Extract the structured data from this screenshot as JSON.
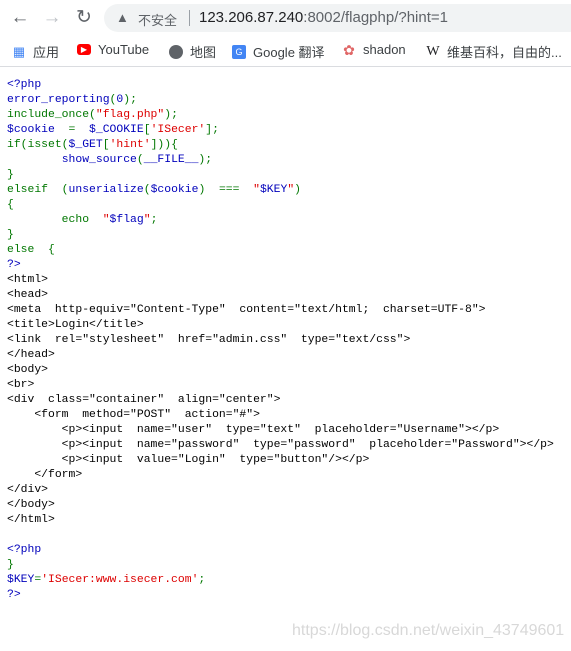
{
  "browser": {
    "security_label": "不安全",
    "url_host": "123.206.87.240",
    "url_rest": ":8002/flagphp/?hint=1"
  },
  "bookmarks": [
    {
      "label": "应用",
      "icon": "apps-grid-icon"
    },
    {
      "label": "YouTube",
      "icon": "youtube-icon"
    },
    {
      "label": "地图",
      "icon": "globe-icon"
    },
    {
      "label": "Google 翻译",
      "icon": "google-translate-icon"
    },
    {
      "label": "shadon",
      "icon": "shadon-icon"
    },
    {
      "label": "维基百科，自由的...",
      "icon": "wikipedia-icon"
    }
  ],
  "colors": {
    "default": "#0000BB",
    "keyword": "#007700",
    "string": "#DD0000",
    "html": "#000000"
  },
  "code": [
    [
      [
        "d",
        "<?php"
      ]
    ],
    [
      [
        "d",
        "error_reporting"
      ],
      [
        "k",
        "("
      ],
      [
        "d",
        "0"
      ],
      [
        "k",
        ");"
      ]
    ],
    [
      [
        "k",
        "include_once("
      ],
      [
        "s",
        "\"flag.php\""
      ],
      [
        "k",
        ");"
      ]
    ],
    [
      [
        "d",
        "$cookie  "
      ],
      [
        "k",
        "=  "
      ],
      [
        "d",
        "$_COOKIE"
      ],
      [
        "k",
        "["
      ],
      [
        "s",
        "'ISecer'"
      ],
      [
        "k",
        "];"
      ]
    ],
    [
      [
        "k",
        "if(isset("
      ],
      [
        "d",
        "$_GET"
      ],
      [
        "k",
        "["
      ],
      [
        "s",
        "'hint'"
      ],
      [
        "k",
        "])){"
      ]
    ],
    [
      [
        "k",
        "        "
      ],
      [
        "d",
        "show_source"
      ],
      [
        "k",
        "("
      ],
      [
        "d",
        "__FILE__"
      ],
      [
        "k",
        ");"
      ]
    ],
    [
      [
        "k",
        "}"
      ]
    ],
    [
      [
        "k",
        "elseif  ("
      ],
      [
        "d",
        "unserialize"
      ],
      [
        "k",
        "("
      ],
      [
        "d",
        "$cookie"
      ],
      [
        "k",
        ")  ===  "
      ],
      [
        "s",
        "\""
      ],
      [
        "d",
        "$KEY"
      ],
      [
        "s",
        "\""
      ],
      [
        "k",
        ")"
      ]
    ],
    [
      [
        "k",
        "{"
      ]
    ],
    [
      [
        "k",
        "        echo  "
      ],
      [
        "s",
        "\""
      ],
      [
        "d",
        "$flag"
      ],
      [
        "s",
        "\""
      ],
      [
        "k",
        ";"
      ]
    ],
    [
      [
        "k",
        "}"
      ]
    ],
    [
      [
        "k",
        "else  {"
      ]
    ],
    [
      [
        "d",
        "?>"
      ]
    ],
    [
      [
        "h",
        "<html>"
      ]
    ],
    [
      [
        "h",
        "<head>"
      ]
    ],
    [
      [
        "h",
        "<meta  http-equiv=\"Content-Type\"  content=\"text/html;  charset=UTF-8\">"
      ]
    ],
    [
      [
        "h",
        "<title>Login</title>"
      ]
    ],
    [
      [
        "h",
        "<link  rel=\"stylesheet\"  href=\"admin.css\"  type=\"text/css\">"
      ]
    ],
    [
      [
        "h",
        "</head>"
      ]
    ],
    [
      [
        "h",
        "<body>"
      ]
    ],
    [
      [
        "h",
        "<br>"
      ]
    ],
    [
      [
        "h",
        "<div  class=\"container\"  align=\"center\">"
      ]
    ],
    [
      [
        "h",
        "    <form  method=\"POST\"  action=\"#\">"
      ]
    ],
    [
      [
        "h",
        "        <p><input  name=\"user\"  type=\"text\"  placeholder=\"Username\"></p>"
      ]
    ],
    [
      [
        "h",
        "        <p><input  name=\"password\"  type=\"password\"  placeholder=\"Password\"></p>"
      ]
    ],
    [
      [
        "h",
        "        <p><input  value=\"Login\"  type=\"button\"/></p>"
      ]
    ],
    [
      [
        "h",
        "    </form>"
      ]
    ],
    [
      [
        "h",
        "</div>"
      ]
    ],
    [
      [
        "h",
        "</body>"
      ]
    ],
    [
      [
        "h",
        "</html>"
      ]
    ],
    [
      [
        "h",
        ""
      ]
    ],
    [
      [
        "d",
        "<?php"
      ]
    ],
    [
      [
        "k",
        "}"
      ]
    ],
    [
      [
        "d",
        "$KEY"
      ],
      [
        "k",
        "="
      ],
      [
        "s",
        "'ISecer:www.isecer.com'"
      ],
      [
        "k",
        ";"
      ]
    ],
    [
      [
        "d",
        "?>"
      ]
    ]
  ],
  "watermark": "https://blog.csdn.net/weixin_43749601"
}
